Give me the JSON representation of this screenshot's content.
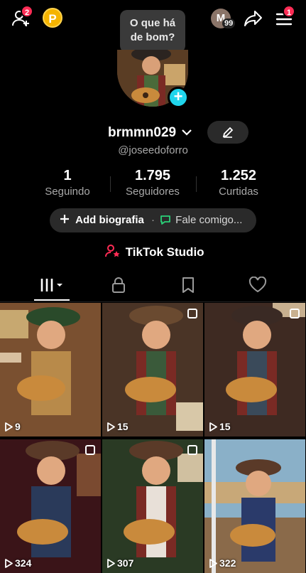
{
  "header": {
    "friends_badge": "2",
    "coin_label": "P",
    "bubble_text_line1": "O que há",
    "bubble_text_line2": "de bom?",
    "mini_avatar_letter": "M",
    "mini_avatar_count": "99",
    "menu_badge": "1"
  },
  "profile": {
    "username": "brmmn029",
    "handle": "@joseedoforro"
  },
  "stats": [
    {
      "value": "1",
      "label": "Seguindo"
    },
    {
      "value": "1.795",
      "label": "Seguidores"
    },
    {
      "value": "1.252",
      "label": "Curtidas"
    }
  ],
  "bio": {
    "add_label": "Add biografia",
    "separator": "·",
    "message_label": "Fale comigo..."
  },
  "studio": {
    "label": "TikTok Studio"
  },
  "videos": [
    {
      "views": "9",
      "pinned": false
    },
    {
      "views": "15",
      "pinned": true
    },
    {
      "views": "15",
      "pinned": true
    },
    {
      "views": "324",
      "pinned": true
    },
    {
      "views": "307",
      "pinned": true
    },
    {
      "views": "322",
      "pinned": false
    }
  ],
  "colors": {
    "accent": "#fe2c55",
    "cyan": "#20d5ec",
    "coin": "#f5b400"
  }
}
